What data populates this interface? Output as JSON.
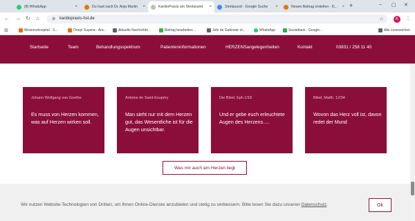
{
  "browser": {
    "tabs": [
      {
        "title": "(8) WhatsApp",
        "color": "#25d366"
      },
      {
        "title": "Du hast nach Dr. Anja Martin",
        "color": "#e37400"
      },
      {
        "title": "KardioPraxis am Strelasund",
        "color": "#8b0e3a"
      },
      {
        "title": "Strelasund - Google Suche",
        "color": "#4285f4"
      },
      {
        "title": "Neuen Beitrag erstellen - D...",
        "color": "#e37400"
      }
    ],
    "new_tab": "+",
    "url": "kardiopraxis-hst.de",
    "profile_initial": "K"
  },
  "bookmarks": {
    "items": [
      {
        "label": "Missionshospital · S...",
        "color": "#e37400"
      },
      {
        "label": "Ooopi Suyana - Ara...",
        "color": "#e37400"
      },
      {
        "label": "Aktuelle Nachrichte...",
        "color": "#5f6368"
      },
      {
        "label": "Beitrag bearbeiten ...",
        "color": "#3bb03b"
      },
      {
        "label": "Jefe de Gabinete ot...",
        "color": "#5f6368"
      },
      {
        "label": "WhatsApp",
        "color": "#25d366"
      },
      {
        "label": "Sozialbank - Google...",
        "color": "#34a853"
      }
    ],
    "all_label": "Alle Lesezeichen"
  },
  "site_nav": {
    "items": [
      "Startseite",
      "Team",
      "Behandlungsspektrum",
      "Patienteninformationen",
      "HERZENSangelegenheiten",
      "Kontakt"
    ],
    "phone": "03831 / 258 11 40"
  },
  "cards": [
    {
      "source": "Johann Wolfgang von Goethe",
      "quote": "Es muss von Herzen kommen, was auf Herzen wirken soll."
    },
    {
      "source": "Antoine de Saint-Exupéry",
      "quote": "Man sieht nur mit dem Herzen gut, das Wesentliche ist für die Augen unsichtbar."
    },
    {
      "source": "Die Bibel, Eph 1/18",
      "quote": "Und er gebe euch erleuchtete Augen des Herzens....."
    },
    {
      "source": "Bibel, Matth. 12/34",
      "quote": "Wovon das Herz voll ist, davon redet der Mund"
    }
  ],
  "more_button": "Was mir auch am Herzen liegt",
  "cookie": {
    "text": "Wir nutzen Website-Technologien von Dritten, um Ihnen Online-Dienste anzubieten und stetig zu verbessern. Bitte lesen Sie dazu unseren ",
    "link": "Datenschutz",
    "end": ".",
    "ok": "Ok"
  },
  "colors": {
    "brand": "#8b0e3a"
  }
}
